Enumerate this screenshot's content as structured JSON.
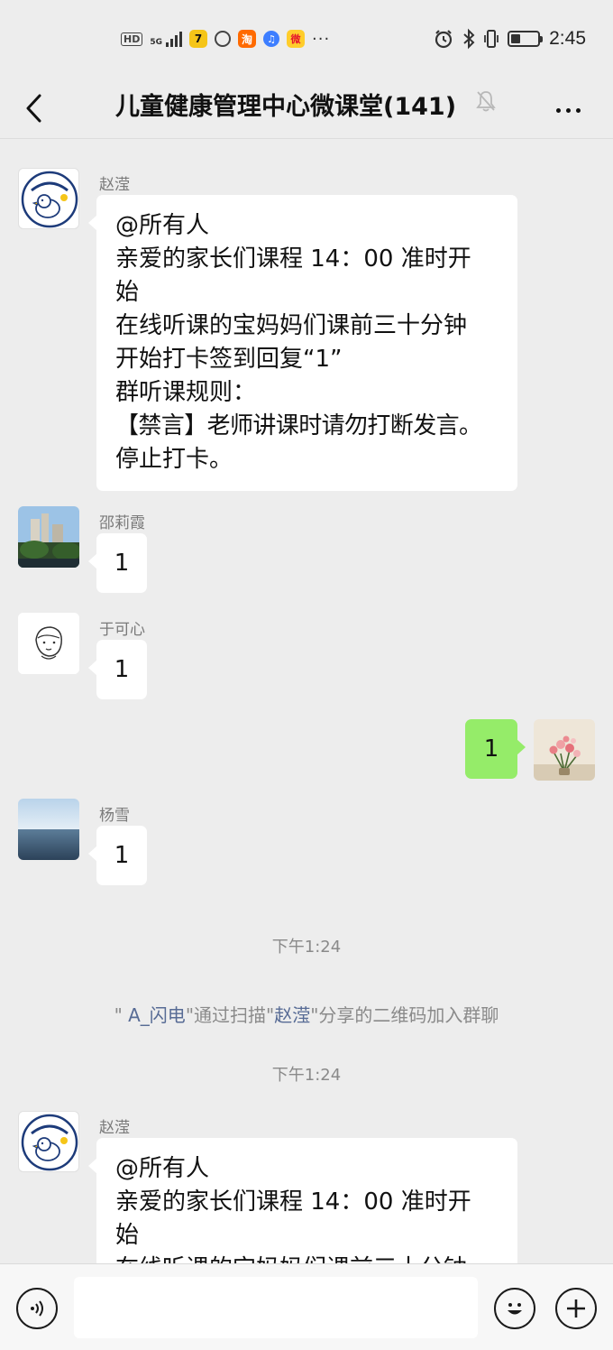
{
  "status_bar": {
    "network_label": "HD",
    "signal_label": "5G",
    "app_icons": [
      {
        "name": "hot-app-icon",
        "glyph": "7",
        "color": "#f5c518"
      },
      {
        "name": "ring-icon",
        "glyph": ""
      },
      {
        "name": "taobao-icon",
        "glyph": "淘",
        "color": "#ff6a00"
      },
      {
        "name": "music-icon",
        "glyph": "♫",
        "color": "#3d7eff"
      },
      {
        "name": "weibo-icon",
        "glyph": "微",
        "color": "#e6162d"
      }
    ],
    "more_icons": "···",
    "battery_level": 0.35,
    "time": "2:45"
  },
  "header": {
    "title": "儿童健康管理中心微课堂(141)",
    "muted": true
  },
  "messages": [
    {
      "sender": "赵滢",
      "lines": [
        "@所有人",
        "亲爱的家长们课程 14：00 准时开",
        "始",
        "在线听课的宝妈妈们课前三十分钟",
        "开始打卡签到回复“1”",
        "群听课规则：",
        "【禁言】老师讲课时请勿打断发言。",
        "停止打卡。"
      ]
    },
    {
      "sender": "邵莉霞",
      "text": "1"
    },
    {
      "sender": "于可心",
      "text": "1"
    },
    {
      "sender": "",
      "text": "1",
      "self": true
    },
    {
      "sender": "杨雪",
      "text": "1"
    },
    {
      "time": "下午1:24"
    },
    {
      "system": {
        "q1": "\" ",
        "user": "A_闪电",
        "p1": "\"通过扫描\"",
        "inviter": "赵滢",
        "p2": "\"分享的二维码加入群聊"
      }
    },
    {
      "time": "下午1:24"
    },
    {
      "sender": "赵滢",
      "lines": [
        "@所有人",
        "亲爱的家长们课程 14：00 准时开",
        "始",
        "在线听课的宝妈妈们课前三十分钟"
      ]
    }
  ],
  "input": {
    "value": "",
    "placeholder": ""
  },
  "colors": {
    "background": "#ededed",
    "self_bubble": "#95ec69",
    "other_bubble": "#ffffff",
    "link": "#576b95"
  }
}
